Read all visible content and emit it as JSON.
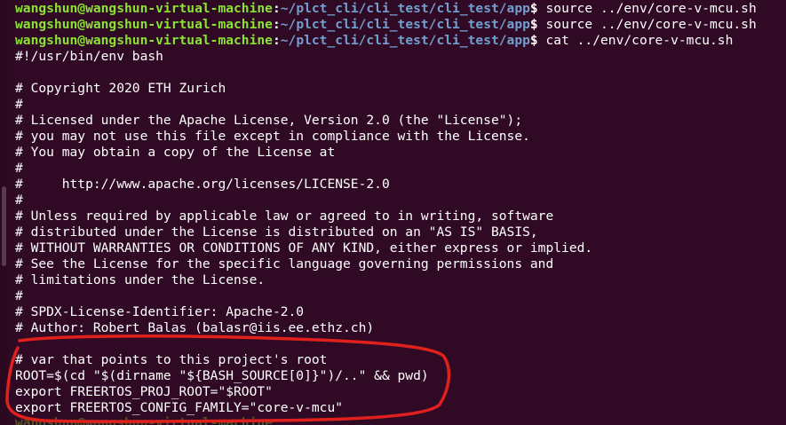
{
  "terminal": {
    "prompts": [
      {
        "user": "wangshun@wangshun-virtual-machine",
        "path": "~/plct_cli/cli_test/cli_test/app",
        "command": " source ../env/core-v-mcu.sh"
      },
      {
        "user": "wangshun@wangshun-virtual-machine",
        "path": "~/plct_cli/cli_test/cli_test/app",
        "command": " source ../env/core-v-mcu.sh"
      },
      {
        "user": "wangshun@wangshun-virtual-machine",
        "path": "~/plct_cli/cli_test/cli_test/app",
        "command": " cat ../env/core-v-mcu.sh"
      }
    ],
    "output_lines": [
      "#!/usr/bin/env bash",
      "",
      "# Copyright 2020 ETH Zurich",
      "#",
      "# Licensed under the Apache License, Version 2.0 (the \"License\");",
      "# you may not use this file except in compliance with the License.",
      "# You may obtain a copy of the License at",
      "#",
      "#     http://www.apache.org/licenses/LICENSE-2.0",
      "#",
      "# Unless required by applicable law or agreed to in writing, software",
      "# distributed under the License is distributed on an \"AS IS\" BASIS,",
      "# WITHOUT WARRANTIES OR CONDITIONS OF ANY KIND, either express or implied.",
      "# See the License for the specific language governing permissions and",
      "# limitations under the License.",
      "#",
      "# SPDX-License-Identifier: Apache-2.0",
      "# Author: Robert Balas (balasr@iis.ee.ethz.ch)",
      "",
      "# var that points to this project's root",
      "ROOT=$(cd \"$(dirname \"${BASH_SOURCE[0]}\")/..\" && pwd)",
      "export FREERTOS_PROJ_ROOT=\"$ROOT\"",
      "export FREERTOS_CONFIG_FAMILY=\"core-v-mcu\""
    ],
    "prompt_separator": ":",
    "prompt_symbol": "$",
    "colors": {
      "background": "#300a24",
      "user": "#8ae234",
      "path": "#729fcf",
      "text": "#ffffff",
      "annotation": "#e0201c"
    }
  }
}
